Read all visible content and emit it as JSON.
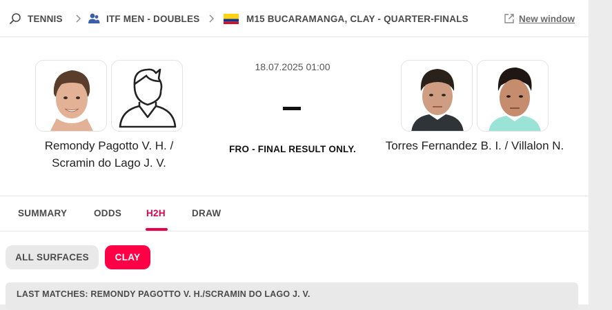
{
  "breadcrumb": {
    "sport": "TENNIS",
    "category": "ITF MEN - DOUBLES",
    "tournament": "M15 BUCARAMANGA, CLAY - QUARTER-FINALS",
    "new_window": "New window"
  },
  "match": {
    "datetime": "18.07.2025 01:00",
    "score": "-",
    "status": "FRO - FINAL RESULT ONLY.",
    "home": {
      "line1": "Remondy Pagotto V. H. /",
      "line2": "Scramin do Lago J. V."
    },
    "away": {
      "line1": "Torres Fernandez B. I. / Villalon N."
    }
  },
  "tabs": [
    "SUMMARY",
    "ODDS",
    "H2H",
    "DRAW"
  ],
  "active_tab": "H2H",
  "filters": {
    "all_surfaces": "ALL SURFACES",
    "clay": "CLAY",
    "selected": "CLAY"
  },
  "last_matches": "LAST MATCHES: REMONDY PAGOTTO V. H./SCRAMIN DO LAGO J. V.",
  "colors": {
    "accent": "#ff0046",
    "active_tab": "#e5034d"
  },
  "icons": [
    "search-icon",
    "chevron-right-icon",
    "person-group-icon",
    "colombia-flag-icon",
    "external-link-icon",
    "player-placeholder-icon"
  ]
}
